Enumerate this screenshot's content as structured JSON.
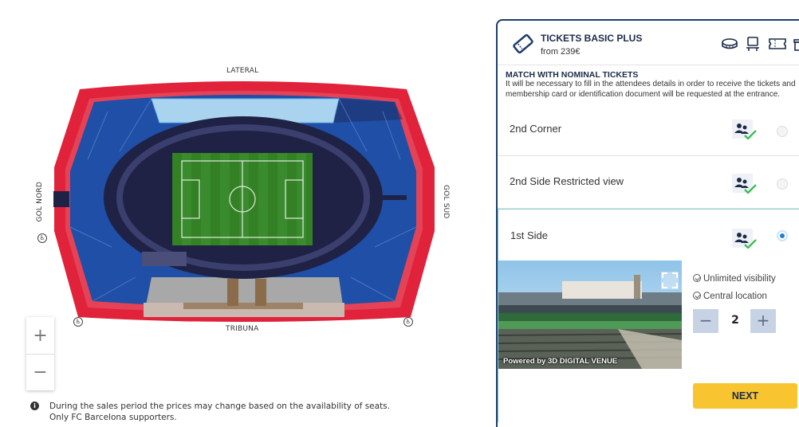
{
  "map": {
    "labels": {
      "top": "LATERAL",
      "bottom": "TRIBUNA",
      "left": "GOL NORD",
      "right": "GOL SUD"
    },
    "zoom": {
      "in": "+",
      "out": "−"
    },
    "colors": {
      "outer_ring": "#e0223a",
      "seats": "#1f4fa6",
      "track": "#1f2244",
      "pitch": "#3a8a2e",
      "restricted": "#a9d3ee",
      "tribuna": "#a8a8a8"
    }
  },
  "note": {
    "icon": "info-icon",
    "line1": "During the sales period the prices may change based on the availability of seats.",
    "line2": "Only FC Barcelona supporters."
  },
  "panel": {
    "title": "TICKETS BASIC PLUS",
    "from": "from 239€",
    "icons": [
      "stadium-icon",
      "seat-icon",
      "ticket-icon",
      "gift-icon"
    ],
    "nominal": {
      "title": "MATCH WITH NOMINAL TICKETS",
      "line1": "It will be necessary to fill in the attendees details in order to receive the tickets and",
      "line2": "membership card or identification document will be requested at the entrance."
    },
    "options": [
      {
        "label": "2nd Corner",
        "selected": false
      },
      {
        "label": "2nd Side Restricted view",
        "selected": false
      },
      {
        "label": "1st Side",
        "selected": true
      }
    ],
    "selected_detail": {
      "image_caption": "Powered by 3D DIGITAL VENUE",
      "features": [
        "Unlimited visibility",
        "Central location"
      ],
      "quantity": "2",
      "minus": "−",
      "plus": "+",
      "next": "NEXT"
    },
    "accent": "#1c3d6e",
    "button_color": "#f8c530"
  }
}
